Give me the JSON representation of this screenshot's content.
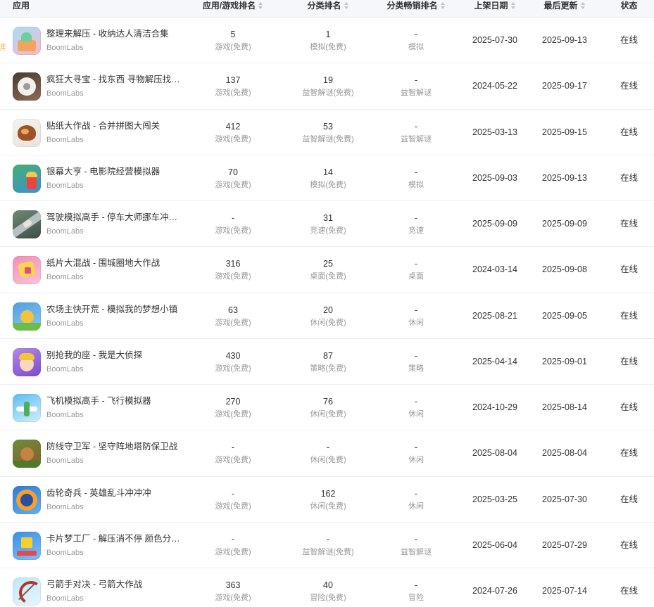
{
  "left_edge_tag": "用",
  "header": {
    "app": "应用",
    "app_rank": "应用/游戏排名",
    "category_rank": "分类排名",
    "category_grossing_rank": "分类畅销排名",
    "release_date": "上架日期",
    "last_update": "最后更新",
    "status": "状态"
  },
  "colors": {
    "text_primary": "#333333",
    "text_secondary": "#999999",
    "header_bg": "#f5f7fa",
    "row_border": "#ebeef5",
    "sort_icon": "#c0c4cc",
    "tag_orange": "#f5a623"
  },
  "rows": [
    {
      "name": "整理来解压 - 收纳达人清洁合集",
      "developer": "BoomLabs",
      "app_rank": {
        "value": "5",
        "chart": "游戏(免费)"
      },
      "category_rank": {
        "value": "1",
        "chart": "模拟(免费)"
      },
      "category_grossing_rank": {
        "value": "-",
        "chart": "模拟"
      },
      "release_date": "2025-07-30",
      "last_update": "2025-09-13",
      "status": "在线",
      "icon": {
        "name": "storage-box-icon",
        "bg": [
          "#a9ddf5",
          "#f6b9cf"
        ],
        "fg": [
          "#f2a45e",
          "#6fcf9b"
        ]
      }
    },
    {
      "name": "疯狂大寻宝 - 找东西 寻物解压找…",
      "developer": "BoomLabs",
      "app_rank": {
        "value": "137",
        "chart": "游戏(免费)"
      },
      "category_rank": {
        "value": "19",
        "chart": "益智解谜(免费)"
      },
      "category_grossing_rank": {
        "value": "-",
        "chart": "益智解谜"
      },
      "release_date": "2024-05-22",
      "last_update": "2025-09-17",
      "status": "在线",
      "icon": {
        "name": "toilet-paper-icon",
        "bg": [
          "#4a3a33",
          "#8c6b55"
        ],
        "fg": [
          "#f4f1ea",
          "#9c9c9c"
        ]
      }
    },
    {
      "name": "贴纸大作战 - 合并拼图大闯关",
      "developer": "BoomLabs",
      "app_rank": {
        "value": "412",
        "chart": "游戏(免费)"
      },
      "category_rank": {
        "value": "53",
        "chart": "益智解谜(免费)"
      },
      "category_grossing_rank": {
        "value": "-",
        "chart": "益智解谜"
      },
      "release_date": "2025-03-13",
      "last_update": "2025-09-15",
      "status": "在线",
      "icon": {
        "name": "mammoth-sticker-icon",
        "bg": [
          "#f6f3ef",
          "#e7e2dc"
        ],
        "fg": [
          "#9b5426",
          "#f0a35a"
        ]
      }
    },
    {
      "name": "银幕大亨 - 电影院经营模拟器",
      "developer": "BoomLabs",
      "app_rank": {
        "value": "70",
        "chart": "游戏(免费)"
      },
      "category_rank": {
        "value": "14",
        "chart": "模拟(免费)"
      },
      "category_grossing_rank": {
        "value": "-",
        "chart": "模拟"
      },
      "release_date": "2025-09-03",
      "last_update": "2025-09-13",
      "status": "在线",
      "icon": {
        "name": "popcorn-cinema-icon",
        "bg": [
          "#45b06f",
          "#3e8fd4"
        ],
        "fg": [
          "#e8463c",
          "#f7c84a"
        ]
      }
    },
    {
      "name": "驾驶模拟高手 - 停车大师挪车冲冲冲",
      "developer": "BoomLabs",
      "app_rank": {
        "value": "-",
        "chart": "游戏(免费)"
      },
      "category_rank": {
        "value": "31",
        "chart": "竞速(免费)"
      },
      "category_grossing_rank": {
        "value": "-",
        "chart": "竞速"
      },
      "release_date": "2025-09-09",
      "last_update": "2025-09-09",
      "status": "在线",
      "icon": {
        "name": "parking-car-icon",
        "bg": [
          "#6f8a73",
          "#3f4d47"
        ],
        "fg": [
          "#b7c0c4",
          "#e9e4d8"
        ]
      }
    },
    {
      "name": "纸片大混战 - 围城圈地大作战",
      "developer": "BoomLabs",
      "app_rank": {
        "value": "316",
        "chart": "游戏(免费)"
      },
      "category_rank": {
        "value": "25",
        "chart": "桌面(免费)"
      },
      "category_grossing_rank": {
        "value": "-",
        "chart": "桌面"
      },
      "release_date": "2024-03-14",
      "last_update": "2025-09-08",
      "status": "在线",
      "icon": {
        "name": "paper-island-icon",
        "bg": [
          "#f48db6",
          "#f9c3d8"
        ],
        "fg": [
          "#f7d647",
          "#e04b8a"
        ]
      }
    },
    {
      "name": "农场主快开荒 - 模拟我的梦想小镇",
      "developer": "BoomLabs",
      "app_rank": {
        "value": "63",
        "chart": "游戏(免费)"
      },
      "category_rank": {
        "value": "20",
        "chart": "休闲(免费)"
      },
      "category_grossing_rank": {
        "value": "-",
        "chart": "休闲"
      },
      "release_date": "2025-08-21",
      "last_update": "2025-09-05",
      "status": "在线",
      "icon": {
        "name": "farm-town-icon",
        "bg": [
          "#4f9fe0",
          "#8cc9f0"
        ],
        "fg": [
          "#f3c23f",
          "#6dbb4b"
        ]
      }
    },
    {
      "name": "别抢我的座 - 我是大侦探",
      "developer": "BoomLabs",
      "app_rank": {
        "value": "430",
        "chart": "游戏(免费)"
      },
      "category_rank": {
        "value": "87",
        "chart": "策略(免费)"
      },
      "category_grossing_rank": {
        "value": "-",
        "chart": "策略"
      },
      "release_date": "2025-04-14",
      "last_update": "2025-09-01",
      "status": "在线",
      "icon": {
        "name": "seat-detective-icon",
        "bg": [
          "#b38ae6",
          "#7a4bd1"
        ],
        "fg": [
          "#f7d8b8",
          "#f4c53a"
        ]
      }
    },
    {
      "name": "飞机模拟高手 - 飞行模拟器",
      "developer": "BoomLabs",
      "app_rank": {
        "value": "270",
        "chart": "游戏(免费)"
      },
      "category_rank": {
        "value": "76",
        "chart": "休闲(免费)"
      },
      "category_grossing_rank": {
        "value": "-",
        "chart": "休闲"
      },
      "release_date": "2024-10-29",
      "last_update": "2025-08-14",
      "status": "在线",
      "icon": {
        "name": "airplane-icon",
        "bg": [
          "#5cbdf0",
          "#d2effc"
        ],
        "fg": [
          "#ffffff",
          "#4fae5c"
        ]
      }
    },
    {
      "name": "防线守卫军 - 坚守阵地塔防保卫战",
      "developer": "BoomLabs",
      "app_rank": {
        "value": "-",
        "chart": "游戏(免费)"
      },
      "category_rank": {
        "value": "-",
        "chart": "休闲(免费)"
      },
      "category_grossing_rank": {
        "value": "-",
        "chart": "休闲"
      },
      "release_date": "2025-08-04",
      "last_update": "2025-08-04",
      "status": "在线",
      "icon": {
        "name": "tower-defense-icon",
        "bg": [
          "#6a8f3c",
          "#8a5a2e"
        ],
        "fg": [
          "#c4843f",
          "#4e7a2a"
        ]
      }
    },
    {
      "name": "齿轮奇兵 - 英雄乱斗冲冲冲",
      "developer": "BoomLabs",
      "app_rank": {
        "value": "-",
        "chart": "游戏(免费)"
      },
      "category_rank": {
        "value": "162",
        "chart": "休闲(免费)"
      },
      "category_grossing_rank": {
        "value": "-",
        "chart": "休闲"
      },
      "release_date": "2025-03-25",
      "last_update": "2025-07-30",
      "status": "在线",
      "icon": {
        "name": "gear-hero-icon",
        "bg": [
          "#2d7bd6",
          "#63aef2"
        ],
        "fg": [
          "#f5a02c",
          "#2b4e9e"
        ]
      }
    },
    {
      "name": "卡片梦工厂 - 解压消不停 颜色分…",
      "developer": "BoomLabs",
      "app_rank": {
        "value": "-",
        "chart": "游戏(免费)"
      },
      "category_rank": {
        "value": "-",
        "chart": "益智解谜(免费)"
      },
      "category_grossing_rank": {
        "value": "-",
        "chart": "益智解谜"
      },
      "release_date": "2025-06-04",
      "last_update": "2025-07-29",
      "status": "在线",
      "icon": {
        "name": "card-block-icon",
        "bg": [
          "#3b8fe8",
          "#7cc0f7"
        ],
        "fg": [
          "#f8d02e",
          "#e5484d"
        ]
      }
    },
    {
      "name": "弓箭手对决 - 弓箭大作战",
      "developer": "BoomLabs",
      "app_rank": {
        "value": "363",
        "chart": "游戏(免费)"
      },
      "category_rank": {
        "value": "40",
        "chart": "冒险(免费)"
      },
      "category_grossing_rank": {
        "value": "-",
        "chart": "冒险"
      },
      "release_date": "2024-07-26",
      "last_update": "2025-07-14",
      "status": "在线",
      "icon": {
        "name": "bow-arrow-icon",
        "bg": [
          "#bfe6f8",
          "#e6f6fd"
        ],
        "fg": [
          "#b3342c",
          "#7a5a3c"
        ]
      }
    }
  ]
}
